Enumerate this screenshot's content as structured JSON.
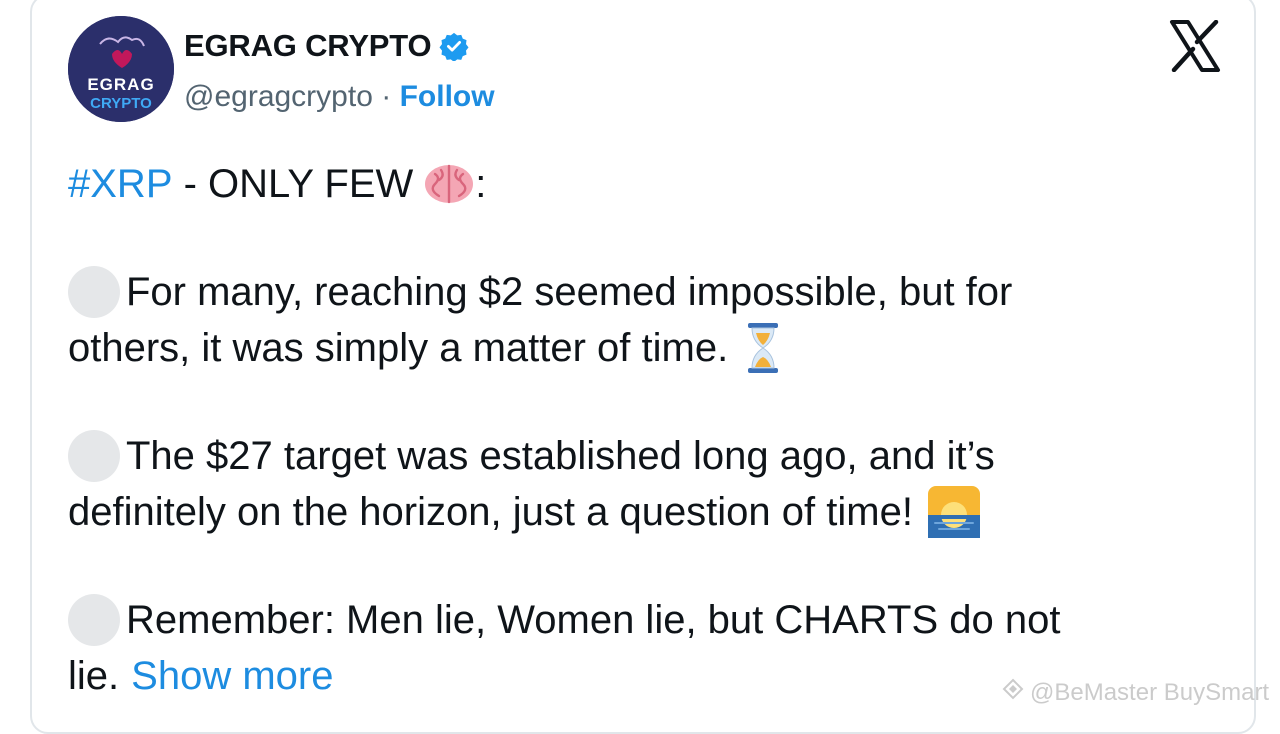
{
  "author": {
    "name": "EGRAG CRYPTO",
    "handle": "@egragcrypto",
    "separator": "·",
    "follow_label": "Follow",
    "avatar_text_top": "EGRAG",
    "avatar_text_bottom": "CRYPTO"
  },
  "tweet": {
    "hashtag": "#XRP",
    "title_rest": " - ONLY FEW",
    "title_colon": ":",
    "p1_line1": "For many, reaching $2 seemed impossible, but for",
    "p1_line2": "others, it was simply a matter of time.",
    "p2_line1": "The $27 target was established long ago, and it’s",
    "p2_line2": "definitely on the horizon, just a question of time!",
    "p3_line1": "Remember: Men lie, Women lie, but CHARTS do not",
    "p3_line2": "lie.",
    "show_more": "Show more"
  },
  "icons": {
    "verified": "verified-badge-icon",
    "x_logo": "x-logo-icon",
    "brain": "brain-emoji-icon",
    "hourglass": "hourglass-emoji-icon",
    "sunrise": "sunrise-emoji-icon",
    "bullet": "white-circle-emoji-icon"
  },
  "colors": {
    "link": "#1d8ce0",
    "text": "#0f1419",
    "muted": "#536471",
    "avatar_bg": "#2b2f6b"
  },
  "watermark": {
    "text": "@BeMaster BuySmart"
  }
}
